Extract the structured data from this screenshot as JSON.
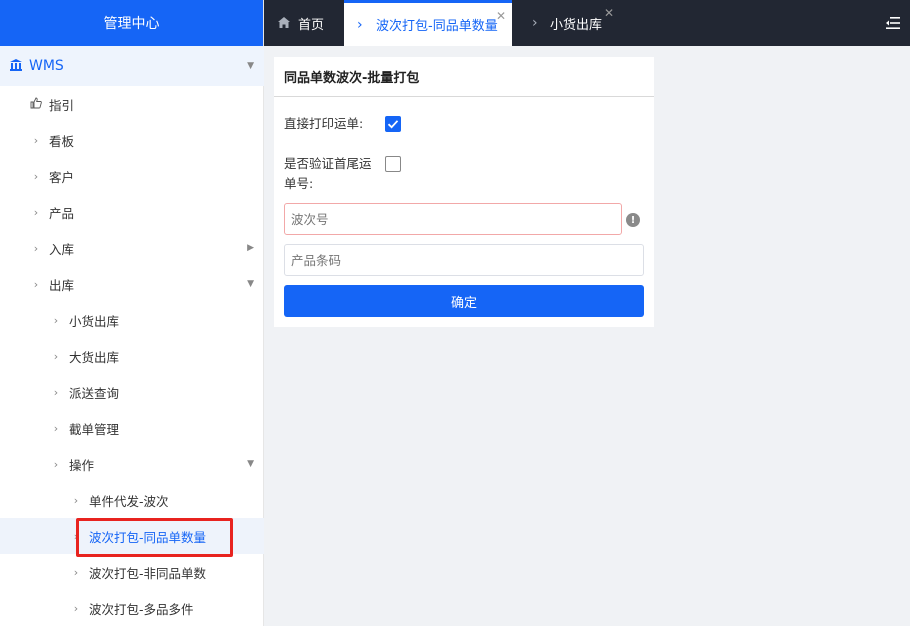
{
  "sidebar": {
    "header_title": "管理中心",
    "wms_label": "WMS",
    "items": [
      {
        "label": "指引"
      },
      {
        "label": "看板"
      },
      {
        "label": "客户"
      },
      {
        "label": "产品"
      },
      {
        "label": "入库"
      },
      {
        "label": "出库"
      },
      {
        "label": "小货出库"
      },
      {
        "label": "大货出库"
      },
      {
        "label": "派送查询"
      },
      {
        "label": "截单管理"
      },
      {
        "label": "操作"
      },
      {
        "label": "单件代发-波次"
      },
      {
        "label": "波次打包-同品单数量"
      },
      {
        "label": "波次打包-非同品单数"
      },
      {
        "label": "波次打包-多品多件"
      }
    ]
  },
  "tabs": [
    {
      "label": "首页"
    },
    {
      "label": "波次打包-同品单数量"
    },
    {
      "label": "小货出库"
    }
  ],
  "form": {
    "title": "同品单数波次-批量打包",
    "print_label": "直接打印运单:",
    "print_checked": true,
    "verify_label_line1": "是否验证首尾运",
    "verify_label_line2": "单号:",
    "verify_checked": false,
    "wave_placeholder": "波次号",
    "barcode_placeholder": "产品条码",
    "confirm_label": "确定"
  },
  "colors": {
    "brand": "#1565f6",
    "topbar": "#222733",
    "highlight": "#e8231f"
  }
}
